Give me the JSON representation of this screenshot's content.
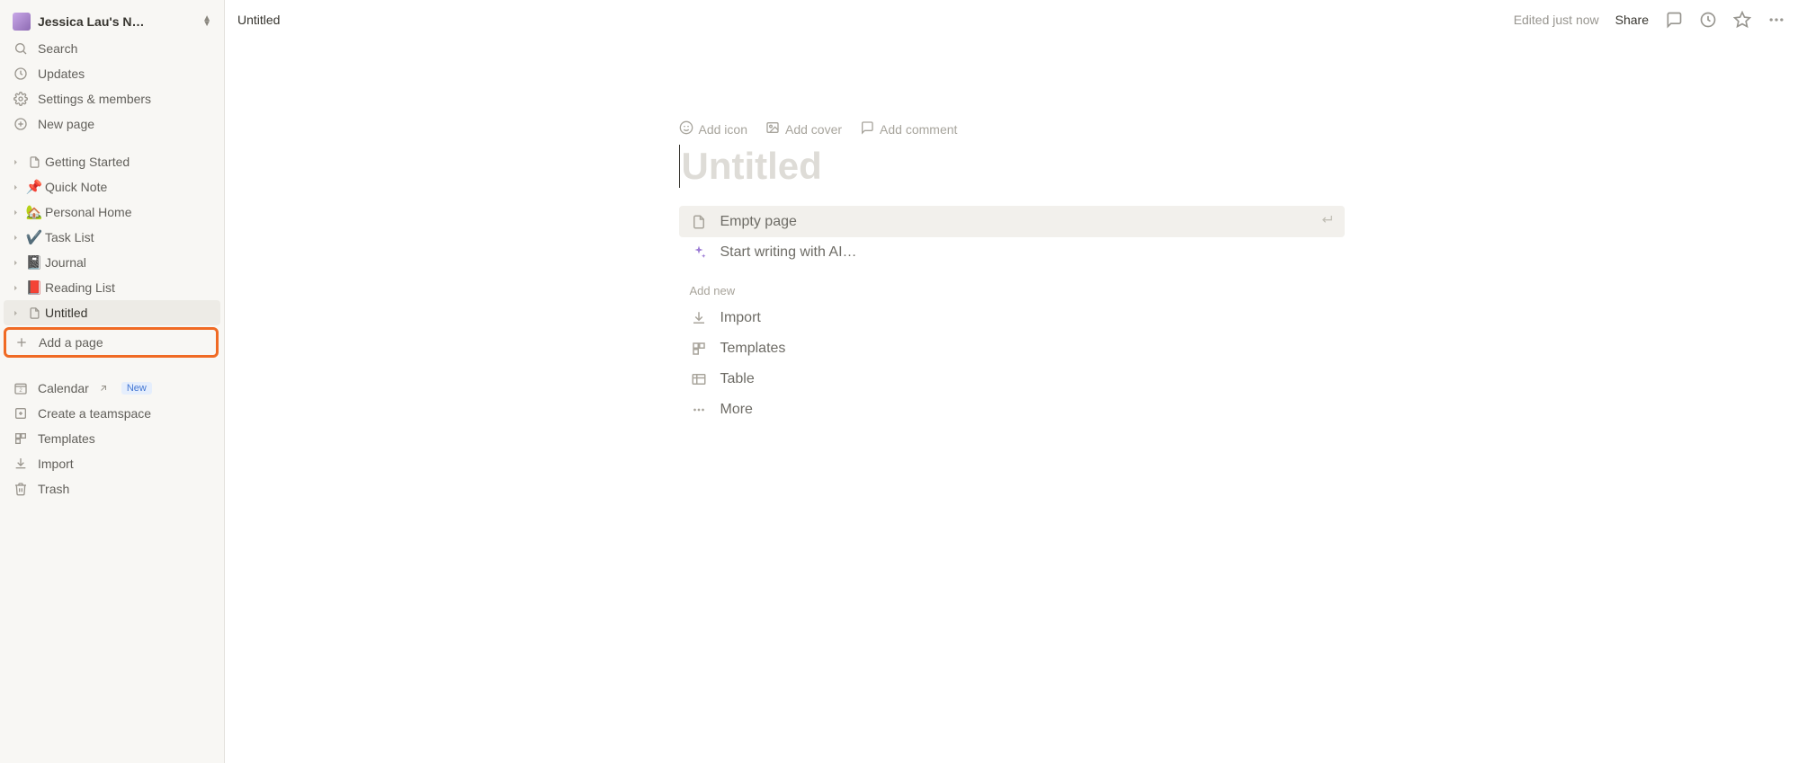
{
  "workspace": {
    "name": "Jessica Lau's N…"
  },
  "sidebar": {
    "search": "Search",
    "updates": "Updates",
    "settings": "Settings & members",
    "new_page": "New page",
    "pages": [
      {
        "emoji": "",
        "doc": true,
        "label": "Getting Started"
      },
      {
        "emoji": "📌",
        "label": "Quick Note"
      },
      {
        "emoji": "🏡",
        "label": "Personal Home"
      },
      {
        "emoji": "✔️",
        "label": "Task List"
      },
      {
        "emoji": "📓",
        "label": "Journal"
      },
      {
        "emoji": "📕",
        "label": "Reading List"
      },
      {
        "emoji": "",
        "doc": true,
        "label": "Untitled",
        "selected": true
      }
    ],
    "add_page": "Add a page",
    "tools": {
      "calendar": "Calendar",
      "calendar_badge": "New",
      "teamspace": "Create a teamspace",
      "templates": "Templates",
      "import": "Import",
      "trash": "Trash"
    }
  },
  "topbar": {
    "breadcrumb": "Untitled",
    "edited": "Edited just now",
    "share": "Share"
  },
  "page": {
    "actions": {
      "add_icon": "Add icon",
      "add_cover": "Add cover",
      "add_comment": "Add comment"
    },
    "title_placeholder": "Untitled",
    "options": {
      "empty": "Empty page",
      "ai": "Start writing with AI…",
      "section": "Add new",
      "import": "Import",
      "templates": "Templates",
      "table": "Table",
      "more": "More"
    }
  }
}
